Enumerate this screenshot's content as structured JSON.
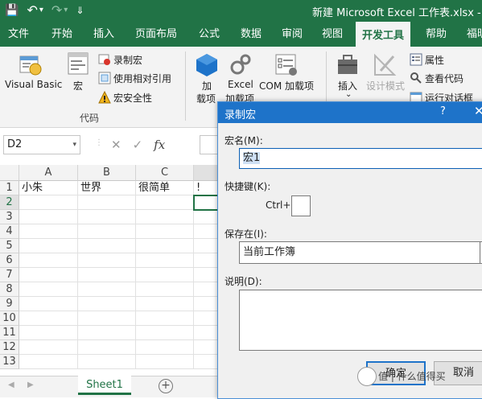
{
  "titlebar": {
    "doc_title": "新建 Microsoft Excel 工作表.xlsx - E",
    "bg": "#217346"
  },
  "qat": {
    "save": "💾",
    "undo": "↶",
    "undo_dd": "▾",
    "redo": "↷",
    "redo_dd": "▾",
    "customize": "⇓"
  },
  "menu": {
    "tabs": [
      "文件",
      "开始",
      "插入",
      "页面布局",
      "公式",
      "数据",
      "审阅",
      "视图",
      "开发工具",
      "帮助",
      "福昕"
    ],
    "active": "开发工具"
  },
  "ribbon": {
    "visual_basic": "Visual Basic",
    "macros": "宏",
    "record_macro": "录制宏",
    "use_relative": "使用相对引用",
    "macro_security": "宏安全性",
    "code_group": "代码",
    "addins_line1": "加",
    "addins_line2": "载项",
    "excel_addins_line1": "Excel",
    "excel_addins_line2": "加载项",
    "com_addins": "COM 加载项",
    "insert": "插入",
    "insert_dd": "⌄",
    "design_mode": "设计模式",
    "properties": "属性",
    "view_code": "查看代码",
    "run_dialog": "运行对话框"
  },
  "formula_bar": {
    "name_box": "D2",
    "cancel": "✕",
    "enter": "✓",
    "fx": "fx"
  },
  "grid": {
    "columns": [
      "A",
      "B",
      "C"
    ],
    "rows": [
      "1",
      "2",
      "3",
      "4",
      "5",
      "6",
      "7",
      "8",
      "9",
      "10",
      "11",
      "12",
      "13"
    ],
    "row1": [
      "小朱",
      "世界",
      "很简单",
      "!"
    ]
  },
  "sheets": {
    "tab": "Sheet1",
    "add": "+",
    "prev": "◀",
    "next": "▶"
  },
  "dialog": {
    "title": "录制宏",
    "help": "?",
    "close": "✕",
    "macro_name_label": "宏名(M):",
    "macro_name_value": "宏1",
    "shortcut_label": "快捷键(K):",
    "ctrl": "Ctrl+",
    "shortcut_value": "",
    "store_label": "保存在(I):",
    "store_value": "当前工作簿",
    "desc_label": "说明(D):",
    "desc_value": "",
    "ok": "确定",
    "cancel": "取消"
  },
  "watermark": {
    "text": "值 | 什么值得买"
  }
}
